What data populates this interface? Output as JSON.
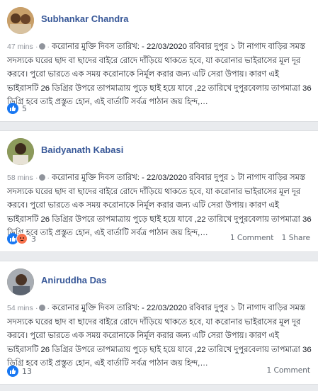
{
  "posts": [
    {
      "author": "Subhankar Chandra",
      "time": "47 mins",
      "separator": "·",
      "text": "করোনার মুক্তি দিবস তারিখ: - 22/03/2020 রবিবার দুপুর ১ টা নাগাদ বাড়ির সমস্ত সদস্যকে ঘরের ছাদ বা ছাদের বাইরে রোদে দাঁড়িয়ে থাকতে হবে, যা করোনার ভাইরাসের মূল দূর করবে। পুরো ভারতে এক সময় করোনাকে নির্মূল করার জন্য এটি সেরা উপায়। কারণ এই ভাইরাসটি 26 ডিগ্রির উপরে তাপমাত্রায় পুড়ে ছাই হয়ে যাবে ,22 তারিখে দুপুরবেলায় তাপমাত্রা 36 ডিগ্রি হবে তাই প্রস্তুত হোন, এই বার্তাটি সর্বত্র পাঠান জয় হিন্দ,…",
      "reactions": "5",
      "comments": "",
      "shares": "",
      "avatar_color": "#b5874e"
    },
    {
      "author": "Baidyanath Kabasi",
      "time": "58 mins",
      "separator": "·",
      "text": "করোনার মুক্তি দিবস তারিখ: - 22/03/2020 রবিবার দুপুর ১ টা নাগাদ বাড়ির সমস্ত সদস্যকে ঘরের ছাদ বা ছাদের বাইরে রোদে দাঁড়িয়ে থাকতে হবে, যা করোনার ভাইরাসের মূল দূর করবে। পুরো ভারতে এক সময় করোনাকে নির্মূল করার জন্য এটি সেরা উপায়। কারণ এই ভাইরাসটি 26 ডিগ্রির উপরে তাপমাত্রায় পুড়ে ছাই হয়ে যাবে ,22 তারিখে দুপুরবেলায় তাপমাত্রা 36 ডিগ্রি হবে তাই প্রস্তুত হোন, এই বার্তাটি সর্বত্র পাঠান জয় হিন্দ,…",
      "reactions": "3",
      "comments": "1 Comment",
      "shares": "1 Share",
      "avatar_color": "#6f7a4a"
    },
    {
      "author": "Aniruddha Das",
      "time": "54 mins",
      "separator": "·",
      "text": "করোনার মুক্তি দিবস তারিখ: - 22/03/2020 রবিবার দুপুর ১ টা নাগাদ বাড়ির সমস্ত সদস্যকে ঘরের ছাদ বা ছাদের বাইরে রোদে দাঁড়িয়ে থাকতে হবে, যা করোনার ভাইরাসের মূল দূর করবে। পুরো ভারতে এক সময় করোনাকে নির্মূল করার জন্য এটি সেরা উপায়। কারণ এই ভাইরাসটি 26 ডিগ্রির উপরে তাপমাত্রায় পুড়ে ছাই হয়ে যাবে ,22 তারিখে দুপুরবেলায় তাপমাত্রা 36 ডিগ্রি হবে তাই প্রস্তুত হোন, এই বার্তাটি সর্বত্র পাঠান জয় হিন্দ,…",
      "reactions": "13",
      "comments": "1 Comment",
      "shares": "",
      "avatar_color": "#7d8187"
    }
  ],
  "colors": {
    "link": "#385898",
    "like": "#1877f2",
    "angry": "#f7714c",
    "meta": "#90949c"
  },
  "icons": [
    "like-icon",
    "angry-icon",
    "globe-icon"
  ]
}
